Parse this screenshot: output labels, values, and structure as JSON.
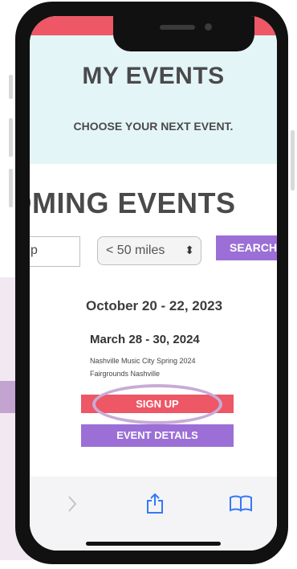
{
  "header": {
    "title": "MY EVENTS",
    "subtitle": "CHOOSE YOUR NEXT EVENT."
  },
  "upcoming": {
    "heading": "COMING EVENTS"
  },
  "search": {
    "zip_value": "p",
    "distance_value": "< 50 miles",
    "button_label": "SEARCH"
  },
  "events": [
    {
      "dates": "October 20 - 22, 2023"
    },
    {
      "dates": "March 28 - 30, 2024",
      "name": "Nashville Music City Spring 2024",
      "venue": "Fairgrounds Nashville",
      "signup_label": "SIGN UP",
      "details_label": "EVENT DETAILS"
    }
  ],
  "toolbar": {
    "icons": [
      "forward-icon",
      "share-icon",
      "bookmarks-icon"
    ]
  },
  "colors": {
    "accent_red": "#ed5766",
    "accent_purple": "#9b6fd6",
    "header_band": "#e4f5f8",
    "highlight": "#c8abd6"
  }
}
